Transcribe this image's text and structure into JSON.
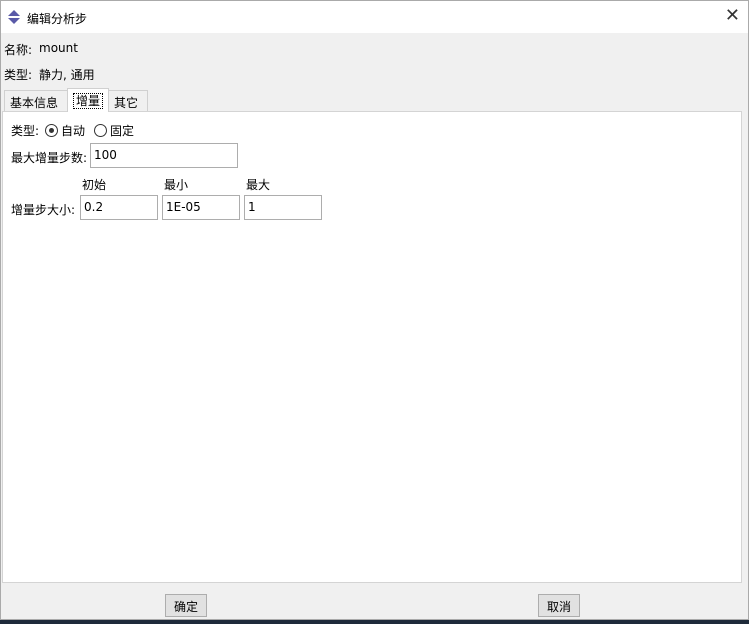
{
  "window": {
    "title": "编辑分析步"
  },
  "header": {
    "name_label": "名称:",
    "name_value": "mount",
    "type_label": "类型:",
    "type_value": "静力, 通用"
  },
  "tabs": [
    {
      "label": "基本信息"
    },
    {
      "label": "增量"
    },
    {
      "label": "其它"
    }
  ],
  "increment": {
    "type_label": "类型:",
    "type_options": [
      {
        "label": "自动",
        "selected": true
      },
      {
        "label": "固定",
        "selected": false
      }
    ],
    "max_steps_label": "最大增量步数:",
    "max_steps_value": "100",
    "size_label": "增量步大小:",
    "col_headers": [
      "初始",
      "最小",
      "最大"
    ],
    "initial": "0.2",
    "minimum": "1E-05",
    "maximum": "1"
  },
  "buttons": {
    "ok": "确定",
    "cancel": "取消"
  }
}
